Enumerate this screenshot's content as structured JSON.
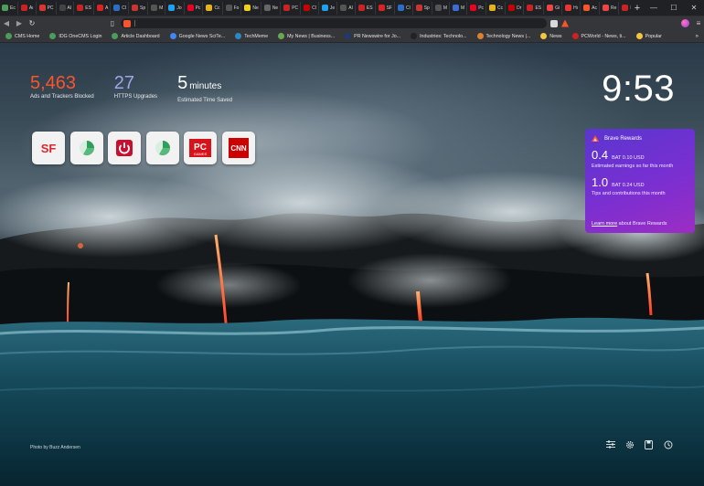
{
  "tabs": [
    {
      "title": "Ec",
      "color": "#4a9d5a"
    },
    {
      "title": "Aı",
      "color": "#c22"
    },
    {
      "title": "PC",
      "color": "#d33"
    },
    {
      "title": "AI",
      "color": "#444"
    },
    {
      "title": "ES",
      "color": "#c22"
    },
    {
      "title": "A",
      "color": "#d22"
    },
    {
      "title": "Cl",
      "color": "#2a6ec7"
    },
    {
      "title": "Sp",
      "color": "#c33"
    },
    {
      "title": "M",
      "color": "#555"
    },
    {
      "title": "Jo",
      "color": "#1da1f2"
    },
    {
      "title": "Pc",
      "color": "#e02"
    },
    {
      "title": "Cc",
      "color": "#e8b21a"
    },
    {
      "title": "Fo",
      "color": "#555"
    },
    {
      "title": "Ne",
      "color": "#f2d11b"
    },
    {
      "title": "Ne",
      "color": "#666"
    },
    {
      "title": "PC",
      "color": "#c22"
    },
    {
      "title": "Cl",
      "color": "#c00"
    },
    {
      "title": "Je",
      "color": "#1da1f2"
    },
    {
      "title": "AI",
      "color": "#555"
    },
    {
      "title": "ES",
      "color": "#c22"
    },
    {
      "title": "SF",
      "color": "#d22"
    },
    {
      "title": "Cl",
      "color": "#2a6ec7"
    },
    {
      "title": "Sp",
      "color": "#c33"
    },
    {
      "title": "M",
      "color": "#555"
    },
    {
      "title": "M",
      "color": "#3a6fd0"
    },
    {
      "title": "Pc",
      "color": "#e02"
    },
    {
      "title": "Cc",
      "color": "#e8b21a"
    },
    {
      "title": "Dr",
      "color": "#c00"
    },
    {
      "title": "ES",
      "color": "#c22"
    },
    {
      "title": "Gi",
      "color": "#e44"
    },
    {
      "title": "Hı",
      "color": "#e33"
    },
    {
      "title": "Ac",
      "color": "#fb542b"
    },
    {
      "title": "Re",
      "color": "#e44"
    },
    {
      "title": "ES",
      "color": "#c22"
    },
    {
      "title": "We",
      "color": "#fb542b",
      "active": true
    }
  ],
  "window_controls": {
    "minimize": "—",
    "maximize": "☐",
    "close": "✕"
  },
  "new_tab_label": "+",
  "bookmarks": [
    {
      "label": "CMS Home",
      "color": "#4a9d5a"
    },
    {
      "label": "IDG OneCMS Login",
      "color": "#4a9d5a"
    },
    {
      "label": "Article Dashboard",
      "color": "#4a9d5a"
    },
    {
      "label": "Google News SciTe...",
      "color": "#4285f4"
    },
    {
      "label": "TechMeme",
      "color": "#2b8ac6"
    },
    {
      "label": "My News | Business...",
      "color": "#6aa84f"
    },
    {
      "label": "PR Newswire for Jo...",
      "color": "#1f3a6e"
    },
    {
      "label": "Industries: Technolo...",
      "color": "#222"
    },
    {
      "label": "Technology News |...",
      "color": "#d9822b"
    },
    {
      "label": "News",
      "color": "#f4c542"
    },
    {
      "label": "PCWorld - News, ti...",
      "color": "#c22"
    },
    {
      "label": "Popular",
      "color": "#f4c542"
    }
  ],
  "bookmarks_more": "»",
  "stats": {
    "ads_blocked": {
      "value": "5,463",
      "label": "Ads and Trackers Blocked",
      "color": "#fb542b"
    },
    "https_upgrades": {
      "value": "27",
      "label": "HTTPS Upgrades",
      "color": "#a0a5eb"
    },
    "time_saved": {
      "value": "5",
      "unit": "minutes",
      "label": "Estimated Time Saved",
      "color": "#ffffff"
    }
  },
  "clock": "9:53",
  "top_sites": [
    {
      "name": "SF",
      "icon": "sf-logo-icon"
    },
    {
      "name": "green-pie",
      "icon": "pie-logo-icon"
    },
    {
      "name": "power",
      "icon": "power-logo-icon"
    },
    {
      "name": "green-pie-2",
      "icon": "pie-logo-icon"
    },
    {
      "name": "PC",
      "sub": "GAMES",
      "icon": "pcgames-logo-icon"
    },
    {
      "name": "CNN",
      "icon": "cnn-logo-icon"
    }
  ],
  "rewards": {
    "title": "Brave Rewards",
    "earnings_value": "0.4",
    "earnings_unit": "BAT 0.10 USD",
    "earnings_label": "Estimated earnings so far this month",
    "tips_value": "1.0",
    "tips_unit": "BAT 0.24 USD",
    "tips_label": "Tips and contributions this month",
    "learn_more": "Learn more",
    "learn_more_suffix": " about Brave Rewards"
  },
  "photo_credit": "Photo by Buzz Andersen",
  "bottom_icons": [
    "sliders-icon",
    "gear-icon",
    "bookmark-save-icon",
    "history-icon"
  ]
}
